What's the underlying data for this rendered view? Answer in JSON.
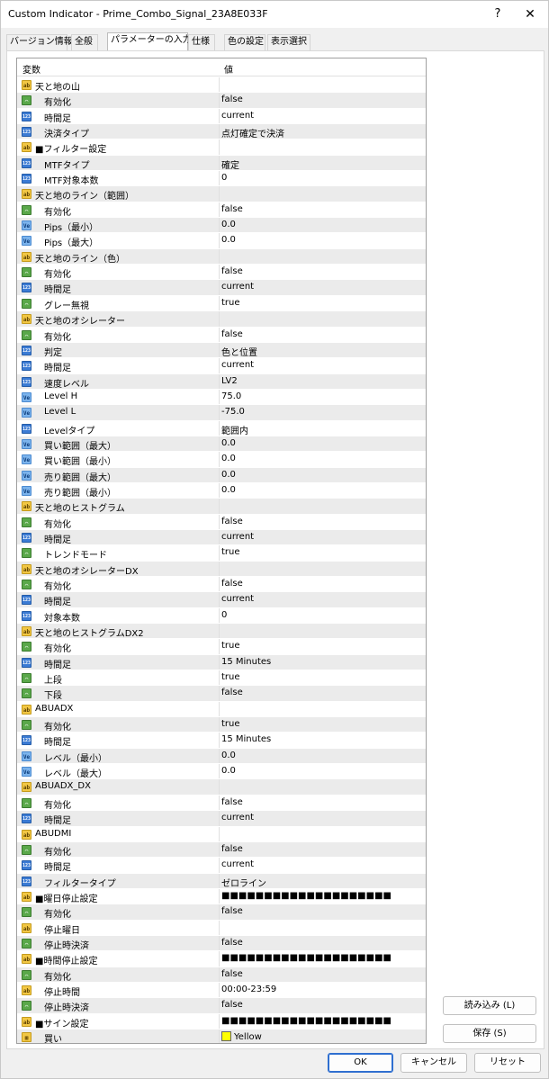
{
  "window": {
    "title": "Custom Indicator - Prime_Combo_Signal_23A8E033F",
    "help_label": "?",
    "close_label": "✕"
  },
  "tabs": [
    {
      "label": "バージョン情報"
    },
    {
      "label": "全般"
    },
    {
      "label": "パラメーターの入力",
      "active": true
    },
    {
      "label": "仕様"
    },
    {
      "label": "色の設定"
    },
    {
      "label": "表示選択"
    }
  ],
  "grid": {
    "col_variable": "変数",
    "col_value": "値",
    "rows": [
      {
        "type": "ab",
        "name": "天と地の山",
        "value": "",
        "group": true
      },
      {
        "type": "bool",
        "name": "有効化",
        "value": "false"
      },
      {
        "type": "int",
        "name": "時間足",
        "value": "current"
      },
      {
        "type": "int",
        "name": "決済タイプ",
        "value": "点灯確定で決済"
      },
      {
        "type": "ab",
        "name": "■フィルター設定",
        "value": "",
        "group": true
      },
      {
        "type": "int",
        "name": "MTFタイプ",
        "value": "確定"
      },
      {
        "type": "int",
        "name": "MTF対象本数",
        "value": "0"
      },
      {
        "type": "ab",
        "name": "天と地のライン（範囲）",
        "value": "",
        "group": true
      },
      {
        "type": "bool",
        "name": "有効化",
        "value": "false"
      },
      {
        "type": "dbl",
        "name": "Pips（最小）",
        "value": "0.0"
      },
      {
        "type": "dbl",
        "name": "Pips（最大）",
        "value": "0.0"
      },
      {
        "type": "ab",
        "name": "天と地のライン（色）",
        "value": "",
        "group": true
      },
      {
        "type": "bool",
        "name": "有効化",
        "value": "false"
      },
      {
        "type": "int",
        "name": "時間足",
        "value": "current"
      },
      {
        "type": "bool",
        "name": "グレー無視",
        "value": "true"
      },
      {
        "type": "ab",
        "name": "天と地のオシレーター",
        "value": "",
        "group": true
      },
      {
        "type": "bool",
        "name": "有効化",
        "value": "false"
      },
      {
        "type": "int",
        "name": "判定",
        "value": "色と位置"
      },
      {
        "type": "int",
        "name": "時間足",
        "value": "current"
      },
      {
        "type": "int",
        "name": "速度レベル",
        "value": "LV2"
      },
      {
        "type": "dbl",
        "name": "Level H",
        "value": "75.0"
      },
      {
        "type": "dbl",
        "name": "Level L",
        "value": "-75.0"
      },
      {
        "type": "int",
        "name": "Levelタイプ",
        "value": "範囲内"
      },
      {
        "type": "dbl",
        "name": "買い範囲（最大）",
        "value": "0.0"
      },
      {
        "type": "dbl",
        "name": "買い範囲（最小）",
        "value": "0.0"
      },
      {
        "type": "dbl",
        "name": "売り範囲（最大）",
        "value": "0.0"
      },
      {
        "type": "dbl",
        "name": "売り範囲（最小）",
        "value": "0.0"
      },
      {
        "type": "ab",
        "name": "天と地のヒストグラム",
        "value": "",
        "group": true
      },
      {
        "type": "bool",
        "name": "有効化",
        "value": "false"
      },
      {
        "type": "int",
        "name": "時間足",
        "value": "current"
      },
      {
        "type": "bool",
        "name": "トレンドモード",
        "value": "true"
      },
      {
        "type": "ab",
        "name": "天と地のオシレーターDX",
        "value": "",
        "group": true
      },
      {
        "type": "bool",
        "name": "有効化",
        "value": "false"
      },
      {
        "type": "int",
        "name": "時間足",
        "value": "current"
      },
      {
        "type": "int",
        "name": "対象本数",
        "value": "0"
      },
      {
        "type": "ab",
        "name": "天と地のヒストグラムDX2",
        "value": "",
        "group": true
      },
      {
        "type": "bool",
        "name": "有効化",
        "value": "true"
      },
      {
        "type": "int",
        "name": "時間足",
        "value": "15 Minutes"
      },
      {
        "type": "bool",
        "name": "上段",
        "value": "true"
      },
      {
        "type": "bool",
        "name": "下段",
        "value": "false"
      },
      {
        "type": "ab",
        "name": "ABUADX",
        "value": "",
        "group": true
      },
      {
        "type": "bool",
        "name": "有効化",
        "value": "true"
      },
      {
        "type": "int",
        "name": "時間足",
        "value": "15 Minutes"
      },
      {
        "type": "dbl",
        "name": "レベル（最小）",
        "value": "0.0"
      },
      {
        "type": "dbl",
        "name": "レベル（最大）",
        "value": "0.0"
      },
      {
        "type": "ab",
        "name": "ABUADX_DX",
        "value": "",
        "group": true
      },
      {
        "type": "bool",
        "name": "有効化",
        "value": "false"
      },
      {
        "type": "int",
        "name": "時間足",
        "value": "current"
      },
      {
        "type": "ab",
        "name": "ABUDMI",
        "value": "",
        "group": true
      },
      {
        "type": "bool",
        "name": "有効化",
        "value": "false"
      },
      {
        "type": "int",
        "name": "時間足",
        "value": "current"
      },
      {
        "type": "int",
        "name": "フィルタータイプ",
        "value": "ゼロライン"
      },
      {
        "type": "ab",
        "name": "■曜日停止設定",
        "value": "■■■■■■■■■■■■■■■■■■■■",
        "group": true
      },
      {
        "type": "bool",
        "name": "有効化",
        "value": "false"
      },
      {
        "type": "ab",
        "name": "停止曜日",
        "value": ""
      },
      {
        "type": "bool",
        "name": "停止時決済",
        "value": "false"
      },
      {
        "type": "ab",
        "name": "■時間停止設定",
        "value": "■■■■■■■■■■■■■■■■■■■■",
        "group": true
      },
      {
        "type": "bool",
        "name": "有効化",
        "value": "false"
      },
      {
        "type": "ab",
        "name": "停止時間",
        "value": "00:00-23:59"
      },
      {
        "type": "bool",
        "name": "停止時決済",
        "value": "false"
      },
      {
        "type": "ab",
        "name": "■サイン設定",
        "value": "■■■■■■■■■■■■■■■■■■■■",
        "group": true
      },
      {
        "type": "color",
        "name": "買い",
        "value": "Yellow",
        "color": "#ffff00"
      }
    ]
  },
  "side_buttons": {
    "load": "読み込み (L)",
    "save": "保存 (S)"
  },
  "footer": {
    "ok": "OK",
    "cancel": "キャンセル",
    "reset": "リセット"
  },
  "colors": {
    "accent": "#2f6fd0",
    "row_alt": "#ebebeb"
  }
}
